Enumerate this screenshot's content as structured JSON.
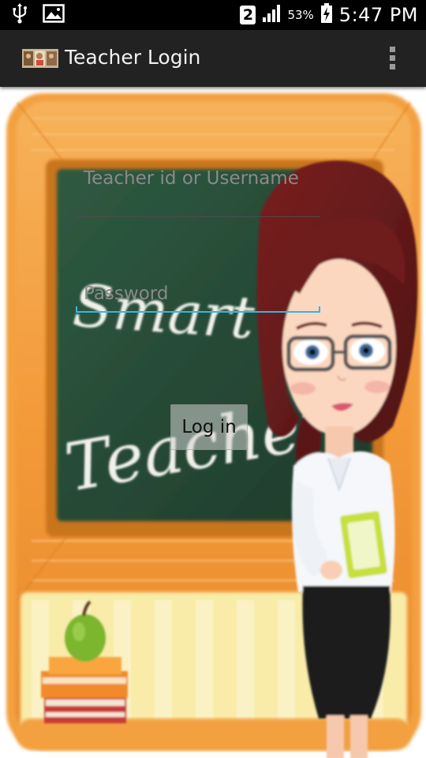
{
  "status_bar": {
    "sim_slot": "2",
    "battery_percent": "53%",
    "time": "5:47 PM",
    "icons": [
      "usb-icon",
      "image-icon",
      "sim-2-icon",
      "signal-icon",
      "battery-charging-icon"
    ]
  },
  "action_bar": {
    "title": "Teacher Login",
    "icons": [
      "app-icon",
      "overflow-menu-icon"
    ]
  },
  "background": {
    "chalkboard_text_line1": "Smart",
    "chalkboard_text_line2": "Teacher"
  },
  "login_form": {
    "id_placeholder": "Teacher id or Username",
    "password_placeholder": "Password",
    "login_label": "Log in"
  },
  "colors": {
    "status_bar": "#000000",
    "action_bar": "#222222",
    "focus_underline": "#33b5e5",
    "board_frame": "#f3a040",
    "chalkboard": "#2c4a36"
  }
}
